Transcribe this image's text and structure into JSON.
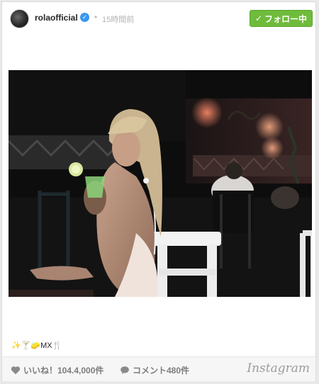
{
  "post": {
    "username": "rolaofficial",
    "timestamp": "15時間前",
    "follow_label": "フォロー中",
    "caption": "✨🍸🧽MX🍴",
    "likes": "いいね！104.4,000件",
    "comments": "コメント480件",
    "brand": "Instagram"
  },
  "icons": {
    "verified": "verified-badge-icon",
    "check": "check-icon",
    "heart": "heart-icon",
    "comment": "comment-bubble-icon"
  },
  "colors": {
    "follow_button": "#6fbb3b",
    "verified": "#3897f0",
    "footer_text": "#7d7d7d"
  }
}
